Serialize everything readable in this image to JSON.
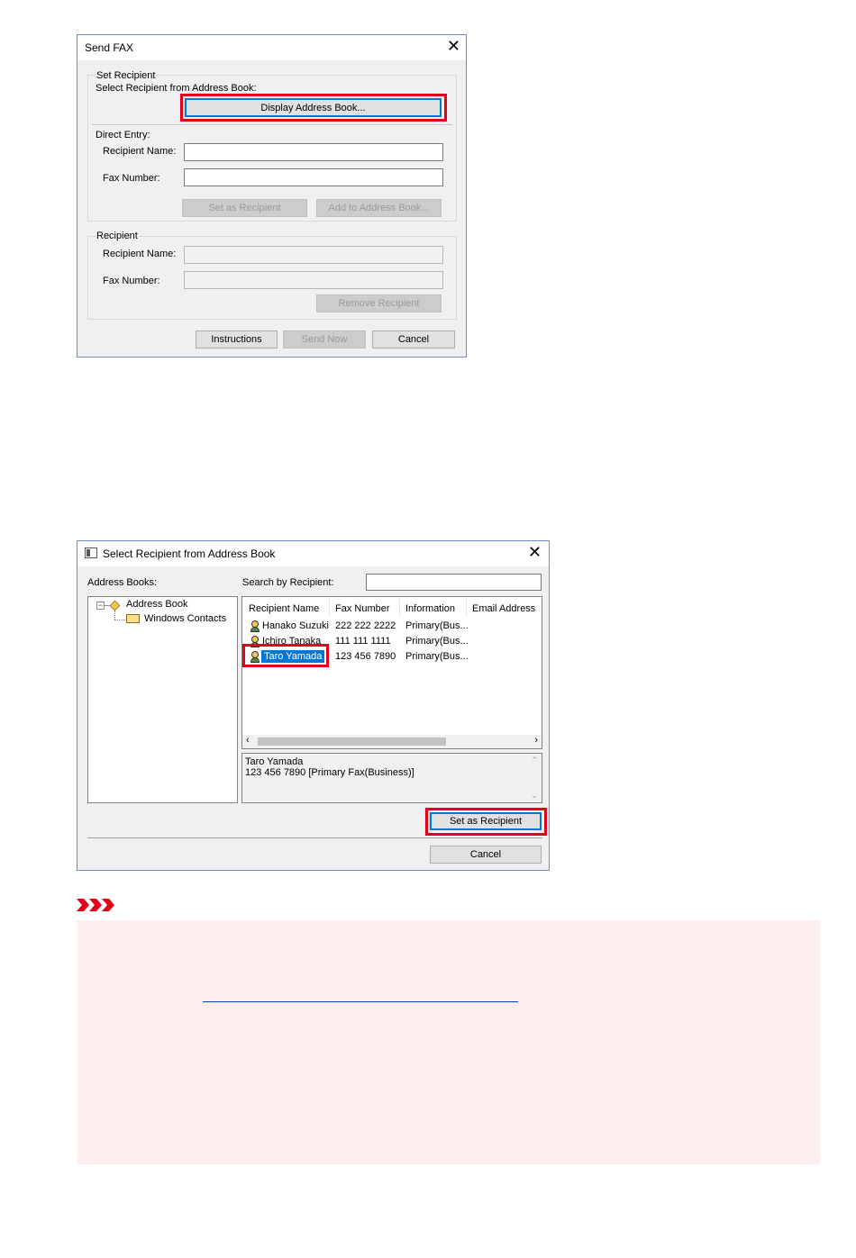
{
  "send_fax": {
    "title": "Send FAX",
    "set_recipient_group": "Set Recipient",
    "select_from_book_label": "Select Recipient from Address Book:",
    "display_address_book_button": "Display Address Book...",
    "direct_entry_label": "Direct Entry:",
    "recipient_name_label": "Recipient Name:",
    "fax_number_label": "Fax Number:",
    "recipient_name_value": "",
    "fax_number_value": "",
    "set_as_recipient_button": "Set as Recipient",
    "add_to_address_book_button": "Add to Address Book...",
    "recipient_group": "Recipient",
    "recipient_recipient_name_label": "Recipient Name:",
    "recipient_fax_number_label": "Fax Number:",
    "remove_recipient_button": "Remove Recipient",
    "instructions_button": "Instructions",
    "send_now_button": "Send Now",
    "cancel_button": "Cancel"
  },
  "address_book": {
    "title": "Select Recipient from Address Book",
    "address_books_label": "Address Books:",
    "search_label": "Search by Recipient:",
    "search_value": "",
    "tree": {
      "root": "Address Book",
      "child": "Windows Contacts"
    },
    "columns": [
      "Recipient Name",
      "Fax Number",
      "Information",
      "Email Address"
    ],
    "rows": [
      {
        "name": "Hanako Suzuki",
        "fax": "222 222 2222",
        "info": "Primary(Bus..."
      },
      {
        "name": "Ichiro Tanaka",
        "fax": "111 111 1111",
        "info": "Primary(Bus..."
      },
      {
        "name": "Taro Yamada",
        "fax": "123 456 7890",
        "info": "Primary(Bus..."
      }
    ],
    "detail_line1": "Taro Yamada",
    "detail_line2": "123 456 7890 [Primary Fax(Business)]",
    "set_as_recipient_button": "Set as Recipient",
    "cancel_button": "Cancel"
  },
  "colors": {
    "highlight_red": "#e3001b",
    "selection_blue": "#0078d7",
    "note_background": "#fdeef0"
  }
}
